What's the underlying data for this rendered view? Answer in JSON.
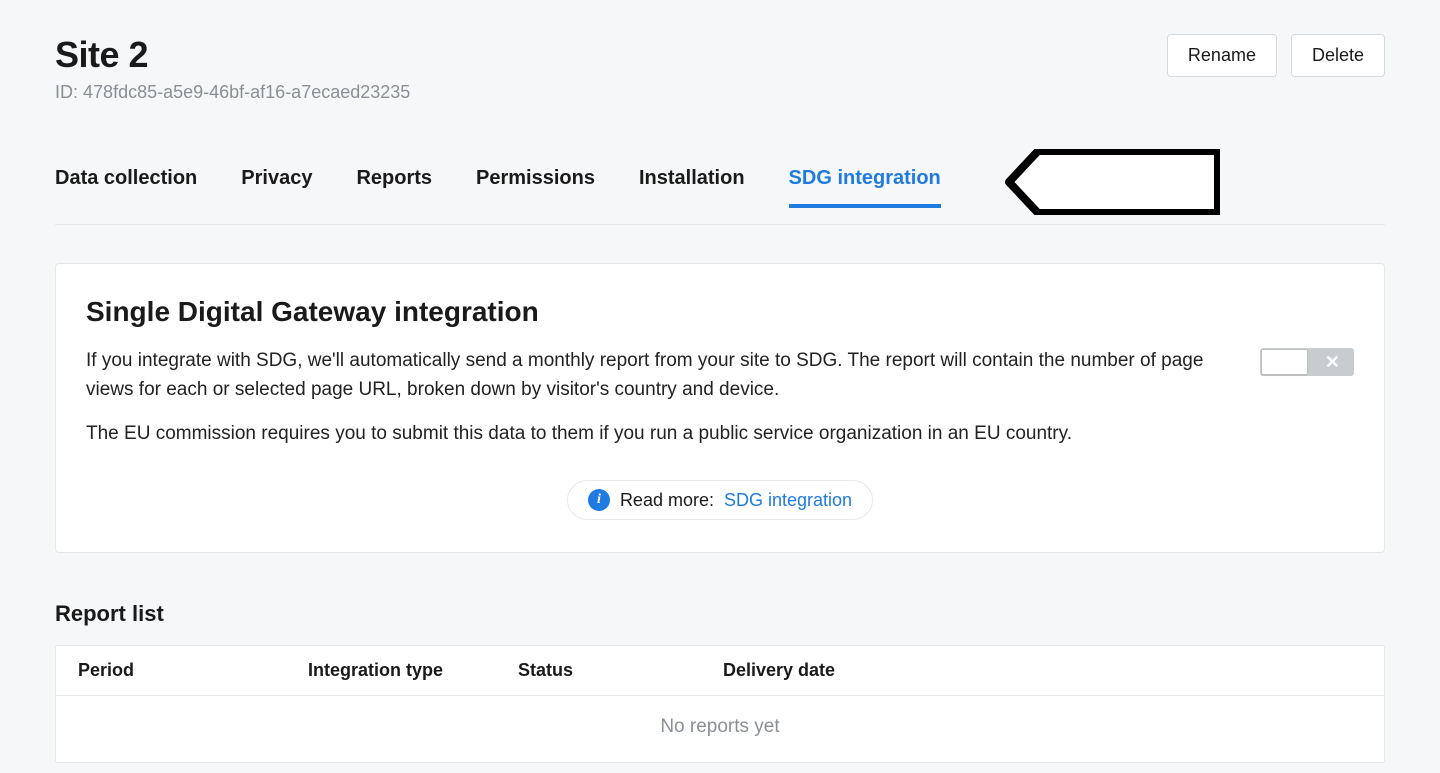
{
  "header": {
    "title": "Site 2",
    "id_label": "ID:",
    "id_value": "478fdc85-a5e9-46bf-af16-a7ecaed23235",
    "actions": {
      "rename": "Rename",
      "delete": "Delete"
    }
  },
  "tabs": {
    "data_collection": "Data collection",
    "privacy": "Privacy",
    "reports": "Reports",
    "permissions": "Permissions",
    "installation": "Installation",
    "sdg_integration": "SDG integration"
  },
  "card": {
    "title": "Single Digital Gateway integration",
    "p1": "If you integrate with SDG, we'll automatically send a monthly report from your site to SDG. The report will contain the number of page views for each or selected page URL, broken down by visitor's country and device.",
    "p2": "The EU commission requires you to submit this data to them if you run a public service organization in an EU country.",
    "read_more_label": "Read more:",
    "read_more_link": "SDG integration",
    "toggle_state": "off"
  },
  "report_list": {
    "title": "Report list",
    "columns": {
      "period": "Period",
      "integration_type": "Integration type",
      "status": "Status",
      "delivery_date": "Delivery date"
    },
    "empty": "No reports yet"
  }
}
